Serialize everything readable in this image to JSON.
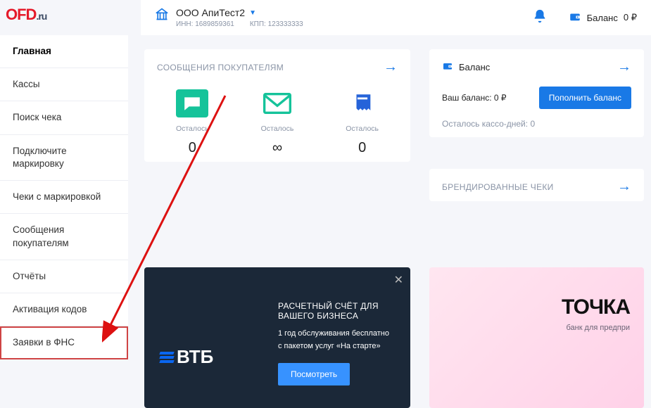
{
  "logo": {
    "main": "OFD",
    "suffix": ".ru"
  },
  "header": {
    "org_name": "ООО АпиТест2",
    "inn_label": "ИНН:",
    "inn_value": "1689859361",
    "kpp_label": "КПП:",
    "kpp_value": "123333333",
    "balance_label": "Баланс",
    "balance_value": "0 ₽"
  },
  "sidebar": {
    "items": [
      "Главная",
      "Кассы",
      "Поиск чека",
      "Подключите маркировку",
      "Чеки с маркировкой",
      "Сообщения покупателям",
      "Отчёты",
      "Активация кодов",
      "Заявки в ФНС"
    ]
  },
  "messages_card": {
    "title": "СООБЩЕНИЯ ПОКУПАТЕЛЯМ",
    "cells": [
      {
        "label": "Осталось",
        "value": "0"
      },
      {
        "label": "Осталось",
        "value": "∞"
      },
      {
        "label": "Осталось",
        "value": "0"
      }
    ]
  },
  "balance_card": {
    "title": "Баланс",
    "your_balance_label": "Ваш баланс:",
    "your_balance_value": "0 ₽",
    "topup": "Пополнить баланс",
    "days_left_label": "Осталось кассо-дней:",
    "days_left_value": "0"
  },
  "brand_card": {
    "title": "БРЕНДИРОВАННЫЕ ЧЕКИ"
  },
  "promo_vtb": {
    "logo": "ВТБ",
    "headline": "РАСЧЕТНЫЙ СЧЁТ ДЛЯ ВАШЕГО БИЗНЕСА",
    "sub1": "1 год обслуживания бесплатно",
    "sub2": "с пакетом услуг «На старте»",
    "cta": "Посмотреть"
  },
  "promo_tochka": {
    "logo": "ТОЧКА",
    "tagline": "банк для предпри"
  }
}
